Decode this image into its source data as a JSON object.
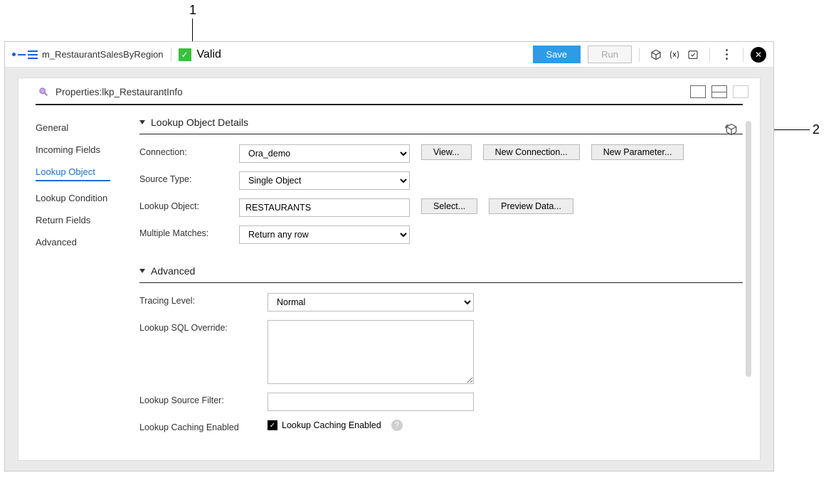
{
  "callouts": {
    "one": "1",
    "two": "2"
  },
  "topbar": {
    "mapping_name": "m_RestaurantSalesByRegion",
    "valid_label": "Valid",
    "save": "Save",
    "run": "Run"
  },
  "panel": {
    "title_prefix": "Properties: ",
    "title_name": "lkp_RestaurantInfo"
  },
  "sidebar": {
    "items": [
      {
        "label": "General"
      },
      {
        "label": "Incoming Fields"
      },
      {
        "label": "Lookup Object"
      },
      {
        "label": "Lookup Condition"
      },
      {
        "label": "Return Fields"
      },
      {
        "label": "Advanced"
      }
    ]
  },
  "sections": {
    "details": {
      "heading": "Lookup Object Details",
      "connection_label": "Connection:",
      "connection_value": "Ora_demo",
      "view_btn": "View...",
      "new_conn_btn": "New Connection...",
      "new_param_btn": "New Parameter...",
      "source_type_label": "Source Type:",
      "source_type_value": "Single Object",
      "lookup_object_label": "Lookup Object:",
      "lookup_object_value": "RESTAURANTS",
      "select_btn": "Select...",
      "preview_btn": "Preview Data...",
      "multiple_label": "Multiple Matches:",
      "multiple_value": "Return any row"
    },
    "advanced": {
      "heading": "Advanced",
      "tracing_label": "Tracing Level:",
      "tracing_value": "Normal",
      "sql_override_label": "Lookup SQL Override:",
      "sql_override_value": "",
      "source_filter_label": "Lookup Source Filter:",
      "source_filter_value": "",
      "caching_label": "Lookup Caching Enabled",
      "caching_check_label": "Lookup Caching Enabled"
    }
  }
}
